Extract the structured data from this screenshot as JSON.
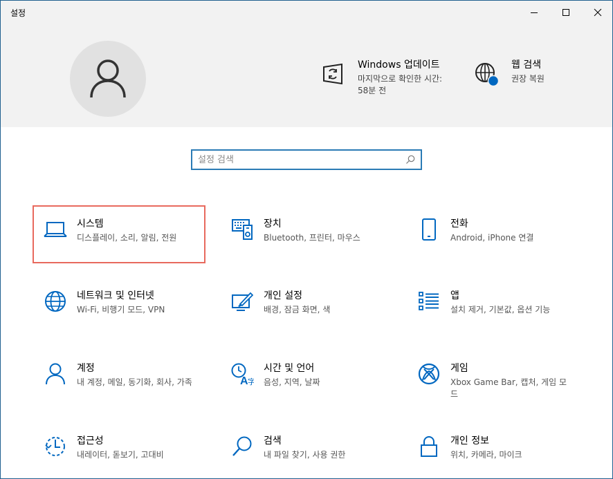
{
  "window": {
    "title": "설정"
  },
  "header": {
    "update": {
      "title": "Windows 업데이트",
      "subtitle": "마지막으로 확인한 시간: 58분 전"
    },
    "web_search": {
      "title": "웹 검색",
      "subtitle": "권장 복원"
    }
  },
  "search": {
    "placeholder": "설정 검색",
    "value": ""
  },
  "tiles": [
    {
      "title": "시스템",
      "desc": "디스플레이, 소리, 알림, 전원",
      "icon": "laptop-icon"
    },
    {
      "title": "장치",
      "desc": "Bluetooth, 프린터, 마우스",
      "icon": "devices-icon"
    },
    {
      "title": "전화",
      "desc": "Android, iPhone 연결",
      "icon": "phone-icon"
    },
    {
      "title": "네트워크 및 인터넷",
      "desc": "Wi-Fi, 비행기 모드, VPN",
      "icon": "globe-icon"
    },
    {
      "title": "개인 설정",
      "desc": "배경, 잠금 화면, 색",
      "icon": "personalization-icon"
    },
    {
      "title": "앱",
      "desc": "설치 제거, 기본값, 옵션 기능",
      "icon": "apps-list-icon"
    },
    {
      "title": "계정",
      "desc": "내 계정, 메일, 동기화, 회사, 가족",
      "icon": "person-icon"
    },
    {
      "title": "시간 및 언어",
      "desc": "음성, 지역, 날짜",
      "icon": "time-language-icon"
    },
    {
      "title": "게임",
      "desc": "Xbox Game Bar, 캡처, 게임 모드",
      "icon": "xbox-icon"
    },
    {
      "title": "접근성",
      "desc": "내레이터, 돋보기, 고대비",
      "icon": "accessibility-icon"
    },
    {
      "title": "검색",
      "desc": "내 파일 찾기, 사용 권한",
      "icon": "search-icon"
    },
    {
      "title": "개인 정보",
      "desc": "위치, 카메라, 마이크",
      "icon": "lock-icon"
    }
  ],
  "colors": {
    "accent": "#0067c0",
    "highlight": "#e8695d",
    "header_bg": "#f2f2f2"
  }
}
